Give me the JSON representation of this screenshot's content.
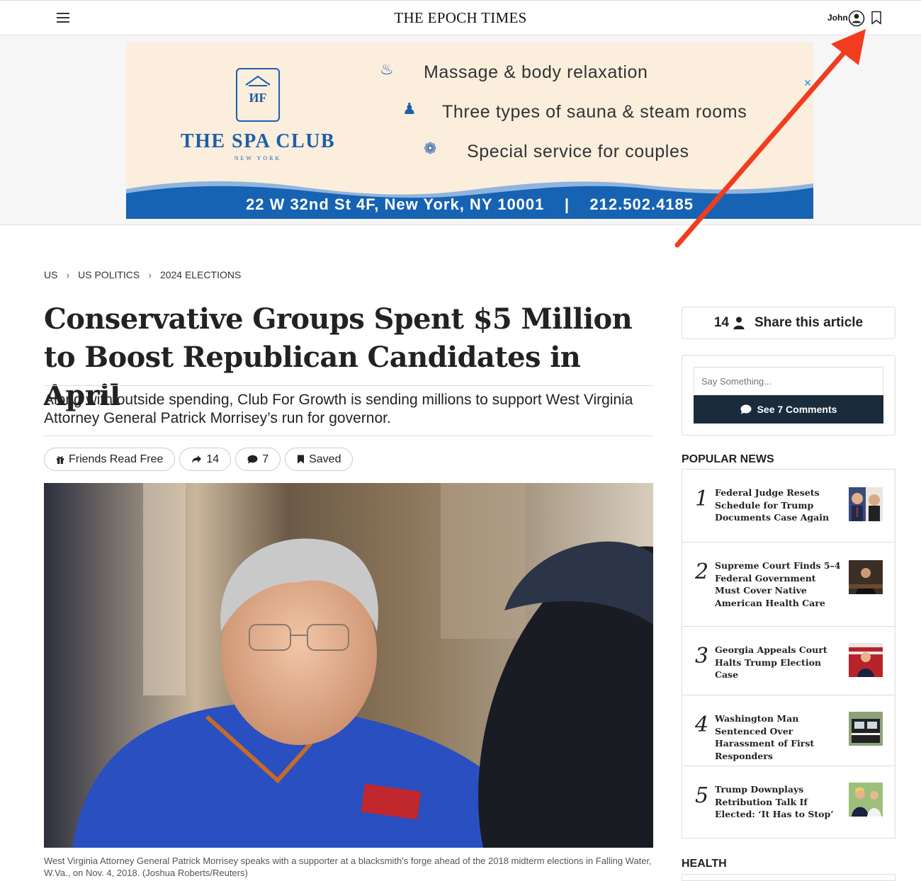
{
  "header": {
    "logo": "THE EPOCH TIMES",
    "user_name": "John"
  },
  "ad": {
    "brand": "THE SPA CLUB",
    "brand_sub": "NEW YORK",
    "line1": "Massage & body relaxation",
    "line2": "Three types of sauna & steam rooms",
    "line3": "Special service for couples",
    "address": "22 W 32nd St 4F, New York, NY 10001    |    212.502.4185",
    "close": "✕"
  },
  "breadcrumb": [
    "US",
    "US POLITICS",
    "2024 ELECTIONS"
  ],
  "article": {
    "title": "Conservative Groups Spent $5 Million to Boost Republican Candidates in April",
    "subtitle": "Along with outside spending, Club For Growth is sending millions to support West Virginia Attorney General Patrick Morrisey’s run for governor.",
    "caption": "West Virginia Attorney General Patrick Morrisey speaks with a supporter at a blacksmith's forge ahead of the 2018 midterm elections in Falling Water, W.Va., on Nov. 4, 2018. (Joshua Roberts/Reuters)"
  },
  "actions": {
    "friends": "Friends Read Free",
    "shares": "14",
    "comments": "7",
    "saved": "Saved"
  },
  "sidebar": {
    "share_count": "14",
    "share_label": "Share this article",
    "comment_placeholder": "Say Something...",
    "comment_button": "See 7 Comments",
    "popular_label": "POPULAR NEWS",
    "health_label": "HEALTH",
    "popular": [
      {
        "num": "1",
        "title": "Federal Judge Resets Schedule for Trump Documents Case Again"
      },
      {
        "num": "2",
        "title": "Supreme Court Finds 5–4 Federal Government Must Cover Native American Health Care"
      },
      {
        "num": "3",
        "title": "Georgia Appeals Court Halts Trump Election Case"
      },
      {
        "num": "4",
        "title": "Washington Man Sentenced Over Harassment of First Responders"
      },
      {
        "num": "5",
        "title": "Trump Downplays Retribution Talk If Elected: ‘It Has to Stop’"
      }
    ]
  },
  "colors": {
    "annotation_arrow": "#f23c1f",
    "comment_button_bg": "#1a2b3c",
    "ad_blue": "#1e5fa8"
  }
}
